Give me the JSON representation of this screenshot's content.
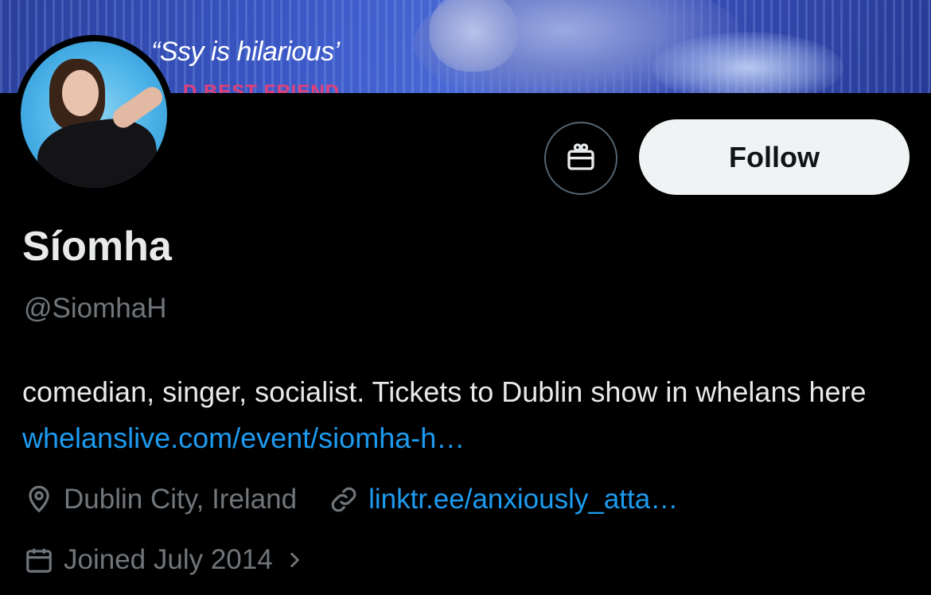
{
  "banner": {
    "tagline": "“Ssy is hilarious’",
    "subline": "D BEST FRIEND"
  },
  "profile": {
    "display_name": "Síomha",
    "handle": "@SiomhaH",
    "bio_text": "comedian, singer, socialist. Tickets to Dublin show in whelans here ",
    "bio_link": "whelanslive.com/event/siomha-h…",
    "location": "Dublin City, Ireland",
    "website": "linktr.ee/anxiously_atta…",
    "joined": "Joined July 2014"
  },
  "actions": {
    "follow_label": "Follow"
  },
  "icons": {
    "gift": "gift-icon",
    "location": "location-pin-icon",
    "link": "link-icon",
    "calendar": "calendar-icon",
    "chevron": "chevron-right-icon"
  },
  "colors": {
    "background": "#000000",
    "text_primary": "#e7e9ea",
    "text_secondary": "#71767b",
    "link": "#1d9bf0",
    "follow_bg": "#eff3f4"
  }
}
